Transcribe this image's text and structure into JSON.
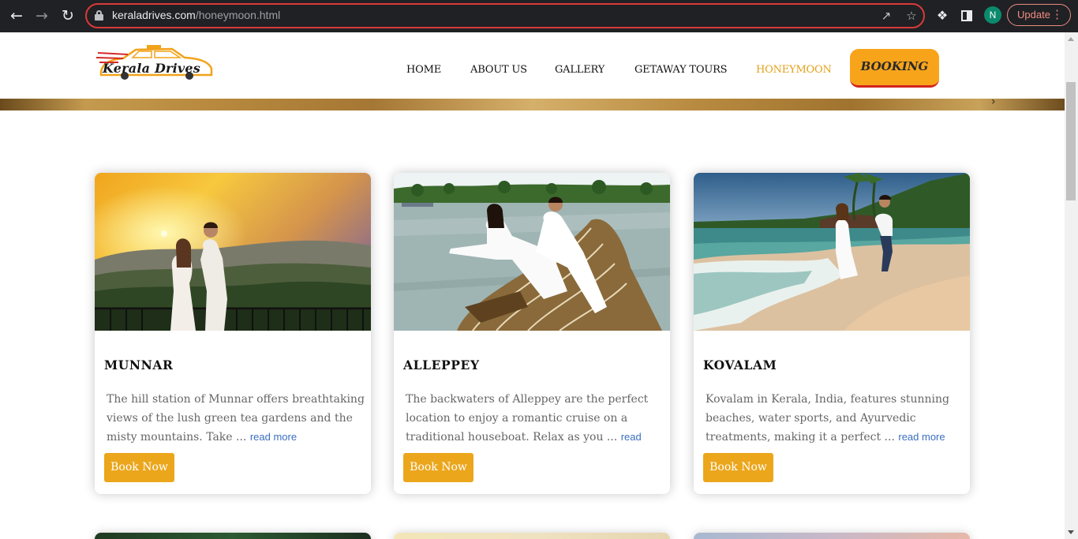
{
  "browser": {
    "url_domain": "keraladrives.com",
    "url_path": "/honeymoon.html",
    "update_label": "Update",
    "profile_initial": "N",
    "icons": [
      "back-icon",
      "forward-icon",
      "reload-icon",
      "lock-icon",
      "share-icon",
      "star-icon",
      "extensions-icon",
      "sidepanel-icon",
      "menu-icon"
    ]
  },
  "header": {
    "logo_text": "Kerala Drives",
    "nav": [
      {
        "label": "HOME",
        "active": false
      },
      {
        "label": "ABOUT US",
        "active": false
      },
      {
        "label": "GALLERY",
        "active": false
      },
      {
        "label": "GETAWAY TOURS",
        "active": false
      },
      {
        "label": "HONEYMOON",
        "active": true
      }
    ],
    "booking_label": "BOOKING"
  },
  "cards": [
    {
      "title": "MUNNAR",
      "text": "The hill station of Munnar offers breathtaking views of the lush green tea gardens and the misty mountains. Take ...",
      "more": "read more",
      "button": "Book Now"
    },
    {
      "title": "ALLEPPEY",
      "text": "The backwaters of Alleppey are the perfect location to enjoy a romantic cruise on a traditional houseboat. Relax as you ...",
      "more": "read more",
      "button": "Book Now"
    },
    {
      "title": "KOVALAM",
      "text": "Kovalam in Kerala, India, features stunning beaches, water sports, and Ayurvedic treatments, making it a perfect ...",
      "more": "read more",
      "button": "Book Now"
    }
  ],
  "colors": {
    "accent": "#eba61c",
    "nav_active": "#e2a21a",
    "booking_bg": "#f8a41b",
    "read_more": "#3b6fc0"
  }
}
